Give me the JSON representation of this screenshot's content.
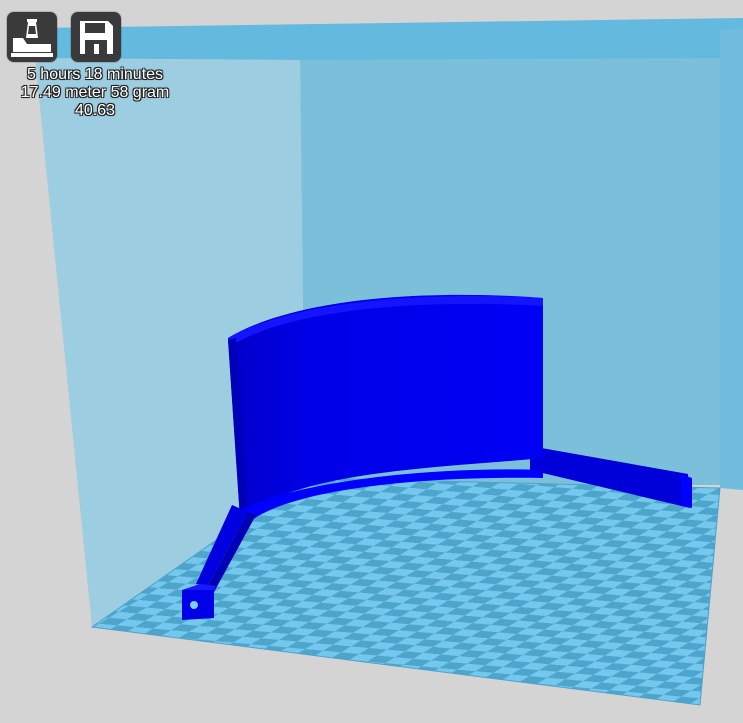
{
  "toolbar": {
    "print_icon": "print-to-printer-icon",
    "save_icon": "save-floppy-icon"
  },
  "print_info": {
    "print_time": "5 hours 18 minutes",
    "material": "17.49 meter 58 gram",
    "cost": "40.63"
  },
  "colors": {
    "build_volume": "#62b7dd",
    "platform_light": "#72c6ec",
    "platform_dark": "#4fa6cd",
    "model": "#0000f0",
    "background": "#d4d4d4",
    "button": "#3a3a3a"
  }
}
